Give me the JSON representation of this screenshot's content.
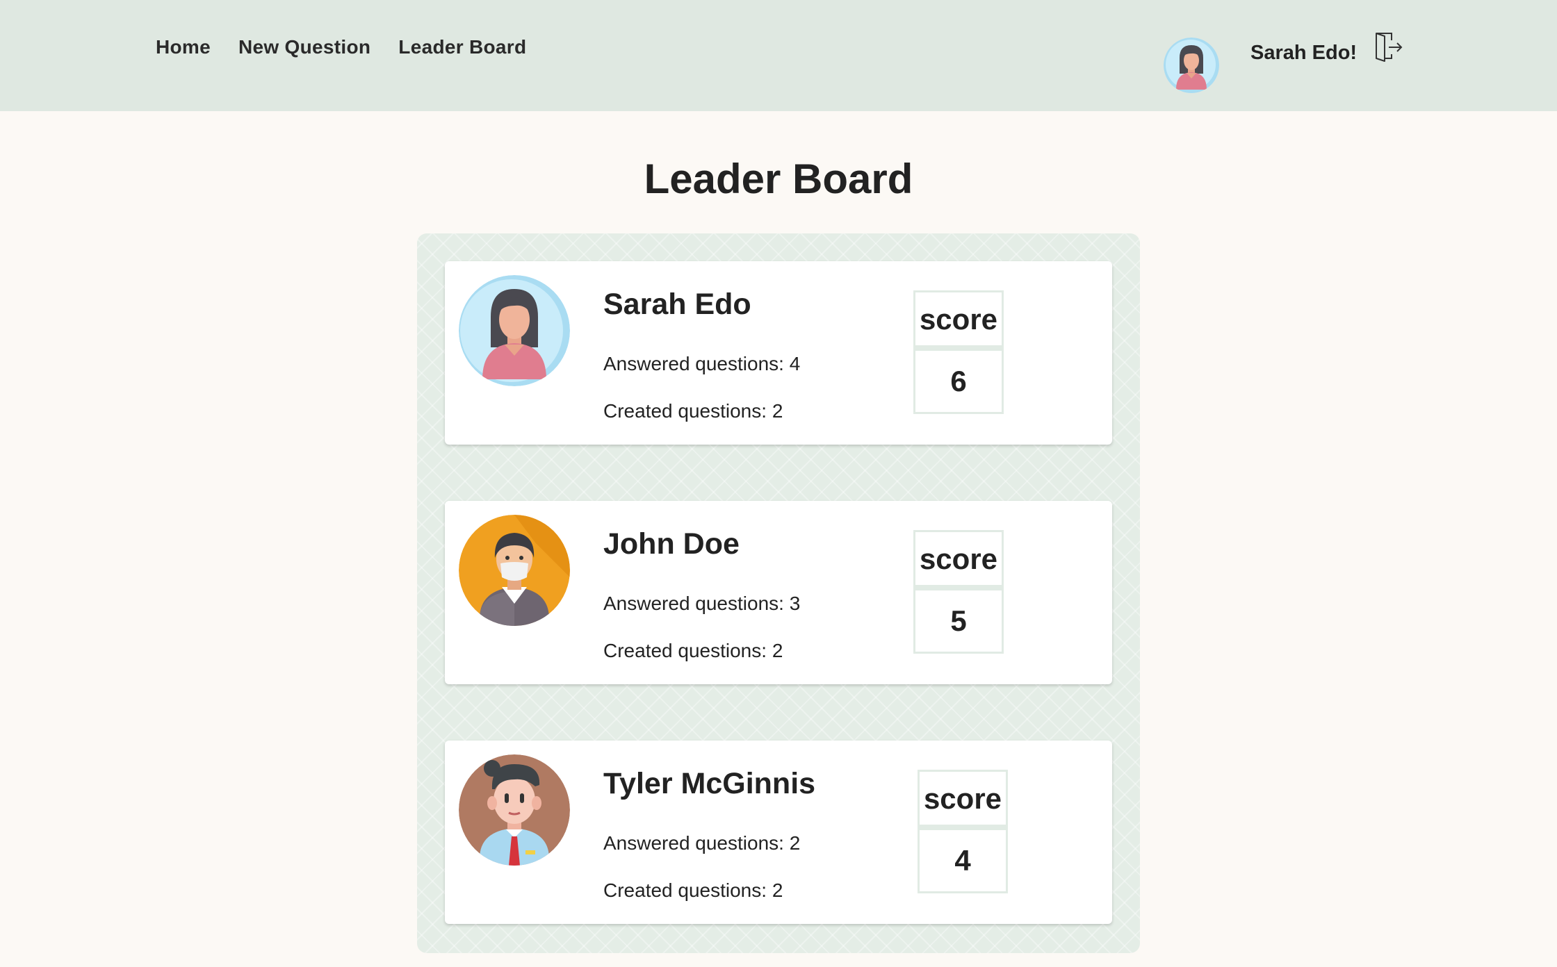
{
  "nav": {
    "links": [
      "Home",
      "New Question",
      "Leader Board"
    ],
    "user_greeting": "Sarah Edo!",
    "logout_icon": "logout-icon"
  },
  "page": {
    "title": "Leader Board"
  },
  "leaders": [
    {
      "name": "Sarah Edo",
      "answered": "Answered questions: 4",
      "created": "Created questions: 2",
      "score_label": "score",
      "score": "6",
      "avatar": "woman-avatar"
    },
    {
      "name": "John Doe",
      "answered": "Answered questions: 3",
      "created": "Created questions: 2",
      "score_label": "score",
      "score": "5",
      "avatar": "masked-man-avatar"
    },
    {
      "name": "Tyler McGinnis",
      "answered": "Answered questions: 2",
      "created": "Created questions: 2",
      "score_label": "score",
      "score": "4",
      "avatar": "man-tie-avatar"
    }
  ],
  "colors": {
    "navbar_bg": "#dfe8e1",
    "page_bg": "#fcf9f5",
    "board_bg": "#e4ede6",
    "card_bg": "#ffffff"
  }
}
